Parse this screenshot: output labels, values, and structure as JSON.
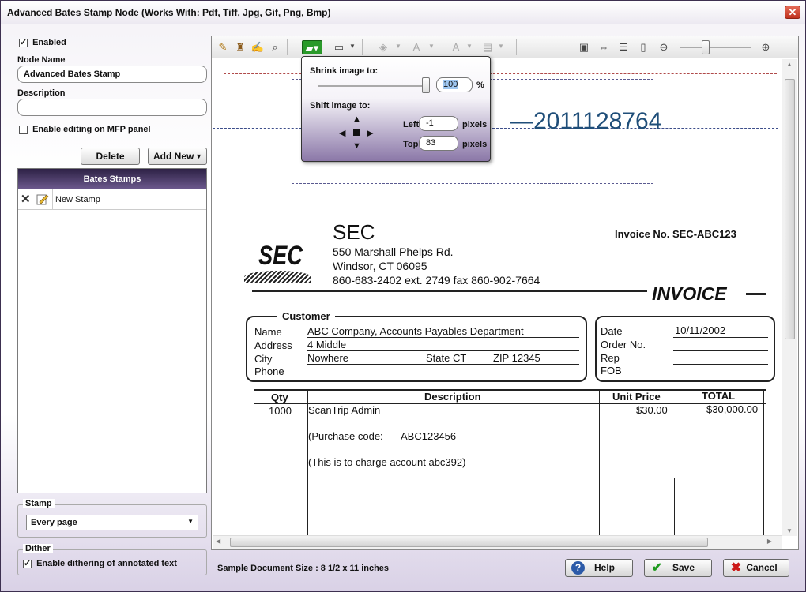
{
  "window": {
    "title": "Advanced Bates Stamp Node   (Works With: Pdf, Tiff, Jpg, Gif, Png, Bmp)",
    "close_glyph": "✕"
  },
  "left_panel": {
    "enabled_label": "Enabled",
    "enabled_checked": true,
    "node_name_label": "Node Name",
    "node_name_value": "Advanced Bates Stamp",
    "description_label": "Description",
    "description_value": "",
    "mfp_label": "Enable editing on MFP panel",
    "mfp_checked": false,
    "delete_button": "Delete",
    "add_new_button": "Add New",
    "bates_header": "Bates Stamps",
    "bates_items": [
      {
        "label": "New Stamp"
      }
    ],
    "stamp_group_title": "Stamp",
    "stamp_select_value": "Every page",
    "dither_group_title": "Dither",
    "dither_label": "Enable dithering of annotated text",
    "dither_checked": true
  },
  "toolbar": {
    "icons": [
      "properties-icon",
      "stamp-icon",
      "edit-icon",
      "preview-icon",
      "image-adjust-icon",
      "border-icon",
      "fill-color-icon",
      "font-color-icon",
      "font-size-icon",
      "layout-icon",
      "view-image-icon",
      "fit-width-icon",
      "fit-height-icon",
      "fit-page-icon",
      "zoom-out-icon",
      "zoom-in-icon"
    ]
  },
  "popup": {
    "shrink_label": "Shrink image to:",
    "shrink_value": "100",
    "shrink_unit": "%",
    "shift_label": "Shift image to:",
    "left_label": "Left",
    "left_value": "-1",
    "left_unit": "pixels",
    "top_label": "Top",
    "top_value": "83",
    "top_unit": "pixels"
  },
  "document": {
    "stamp_text": "2011128764",
    "stamp_color": "#1f4e79",
    "company": "SEC",
    "address1": "550 Marshall Phelps Rd.",
    "address2": "Windsor, CT  06095",
    "phone": "860-683-2402 ext. 2749 fax 860-902-7664",
    "invoice_no": "Invoice No. SEC-ABC123",
    "invoice_title": "INVOICE",
    "customer_title": "Customer",
    "cust_labels": [
      "Name",
      "Address",
      "City",
      "Phone"
    ],
    "cust_name": "ABC Company, Accounts Payables Department",
    "cust_address": "4 Middle",
    "cust_city": "Nowhere",
    "state_label": "State",
    "state_value": "CT",
    "zip_label": "ZIP",
    "zip_value": "12345",
    "date_label": "Date",
    "date_value": "10/11/2002",
    "order_label": "Order No.",
    "rep_label": "Rep",
    "fob_label": "FOB",
    "col_qty": "Qty",
    "col_desc": "Description",
    "col_price": "Unit Price",
    "col_total": "TOTAL",
    "row_qty": "1000",
    "row_desc": "ScanTrip Admin",
    "row_price": "$30.00",
    "row_total": "$30,000.00",
    "purchase_label": "(Purchase code:",
    "purchase_value": "ABC123456",
    "charge_text": "(This is to charge account abc392)"
  },
  "footer": {
    "sample_size": "Sample Document Size : 8 1/2 x 11 inches",
    "help_button": "Help",
    "save_button": "Save",
    "cancel_button": "Cancel"
  }
}
